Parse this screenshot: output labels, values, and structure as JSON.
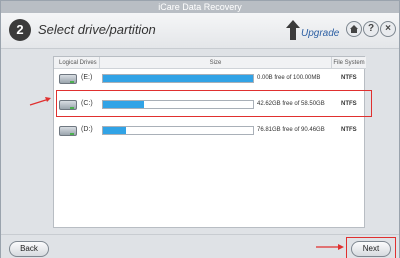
{
  "window": {
    "title": "iCare Data Recovery"
  },
  "header": {
    "step_number": "2",
    "step_title": "Select drive/partition",
    "upgrade_label": "Upgrade",
    "buttons": [
      "home-icon",
      "help-icon",
      "close-icon"
    ]
  },
  "table": {
    "headers": {
      "drives": "Logical Drives",
      "size": "Size",
      "fs": "File System"
    },
    "rows": [
      {
        "label": "(E:)",
        "free": "0.00B free of 100.00MB",
        "fs": "NTFS",
        "used_fraction": 1.0,
        "selected": false
      },
      {
        "label": "(C:)",
        "free": "42.62GB free of 58.50GB",
        "fs": "NTFS",
        "used_fraction": 0.27,
        "selected": true
      },
      {
        "label": "(D:)",
        "free": "76.81GB free of 90.46GB",
        "fs": "NTFS",
        "used_fraction": 0.15,
        "selected": false
      }
    ]
  },
  "footer": {
    "back_label": "Back",
    "next_label": "Next"
  },
  "colors": {
    "accent_bar": "#31a3e6",
    "annotation": "#e0302f"
  }
}
